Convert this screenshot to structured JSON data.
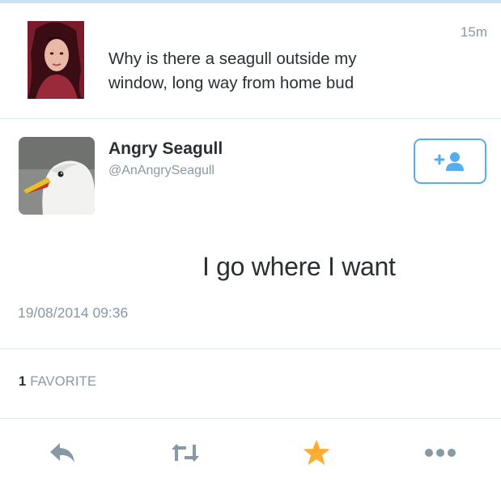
{
  "first_tweet": {
    "text": "Why is there a seagull outside my\nwindow, long way from home bud",
    "time": "15m"
  },
  "second_tweet": {
    "display_name": "Angry Seagull",
    "handle": "@AnAngrySeagull",
    "text": "I go where I want",
    "timestamp": "19/08/2014 09:36",
    "favorite_count": "1",
    "favorite_label": "FAVORITE"
  },
  "actions": [
    "reply-icon",
    "retweet-icon",
    "favorite-star-icon",
    "more-icon"
  ],
  "colors": {
    "accent": "#55acee",
    "muted": "#8899a6",
    "favorite": "#ffac33",
    "divider": "#e1e8ed"
  }
}
